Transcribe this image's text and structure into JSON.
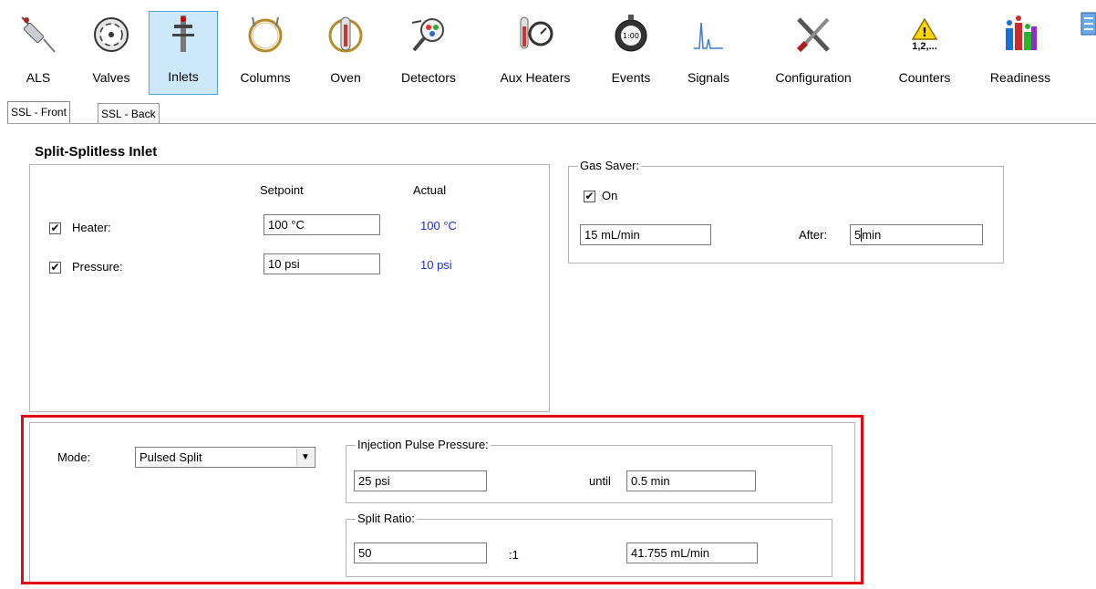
{
  "toolbar": {
    "items": [
      {
        "label": "ALS",
        "icon": "syringe-icon"
      },
      {
        "label": "Valves",
        "icon": "valve-icon"
      },
      {
        "label": "Inlets",
        "icon": "inlet-icon",
        "active": true
      },
      {
        "label": "Columns",
        "icon": "column-coil-icon"
      },
      {
        "label": "Oven",
        "icon": "oven-icon"
      },
      {
        "label": "Detectors",
        "icon": "detector-icon"
      },
      {
        "label": "Aux Heaters",
        "icon": "aux-heater-icon"
      },
      {
        "label": "Events",
        "icon": "stopwatch-icon"
      },
      {
        "label": "Signals",
        "icon": "signal-peak-icon"
      },
      {
        "label": "Configuration",
        "icon": "tools-icon"
      },
      {
        "label": "Counters",
        "icon": "warning-counter-icon",
        "icon_text": "1,2,..."
      },
      {
        "label": "Readiness",
        "icon": "readiness-bars-icon"
      }
    ]
  },
  "tabs": [
    {
      "label": "SSL - Front",
      "active": true
    },
    {
      "label": "SSL - Back",
      "active": false
    }
  ],
  "inlet": {
    "title": "Split-Splitless Inlet",
    "setpoint_header": "Setpoint",
    "actual_header": "Actual",
    "heater": {
      "label": "Heater:",
      "checked": true,
      "setpoint": "100 °C",
      "actual": "100 °C"
    },
    "pressure": {
      "label": "Pressure:",
      "checked": true,
      "setpoint": "10 psi",
      "actual": "10 psi"
    }
  },
  "gas_saver": {
    "legend": "Gas Saver:",
    "on_label": "On",
    "on_checked": true,
    "flow": "15 mL/min",
    "after_label": "After:",
    "after_value_before_cursor": "5",
    "after_value_after_cursor": "min"
  },
  "mode": {
    "label": "Mode:",
    "selected": "Pulsed Split"
  },
  "injection_pulse": {
    "legend": "Injection Pulse Pressure:",
    "pressure": "25 psi",
    "until_label": "until",
    "time": "0.5 min"
  },
  "split_ratio": {
    "legend": "Split Ratio:",
    "ratio": "50",
    "ratio_suffix": ":1",
    "flow": "41.755 mL/min"
  },
  "colors": {
    "actual_value": "#1a2ee0",
    "highlight_box": "#e30613",
    "active_toolbar": "#cde8fb"
  }
}
